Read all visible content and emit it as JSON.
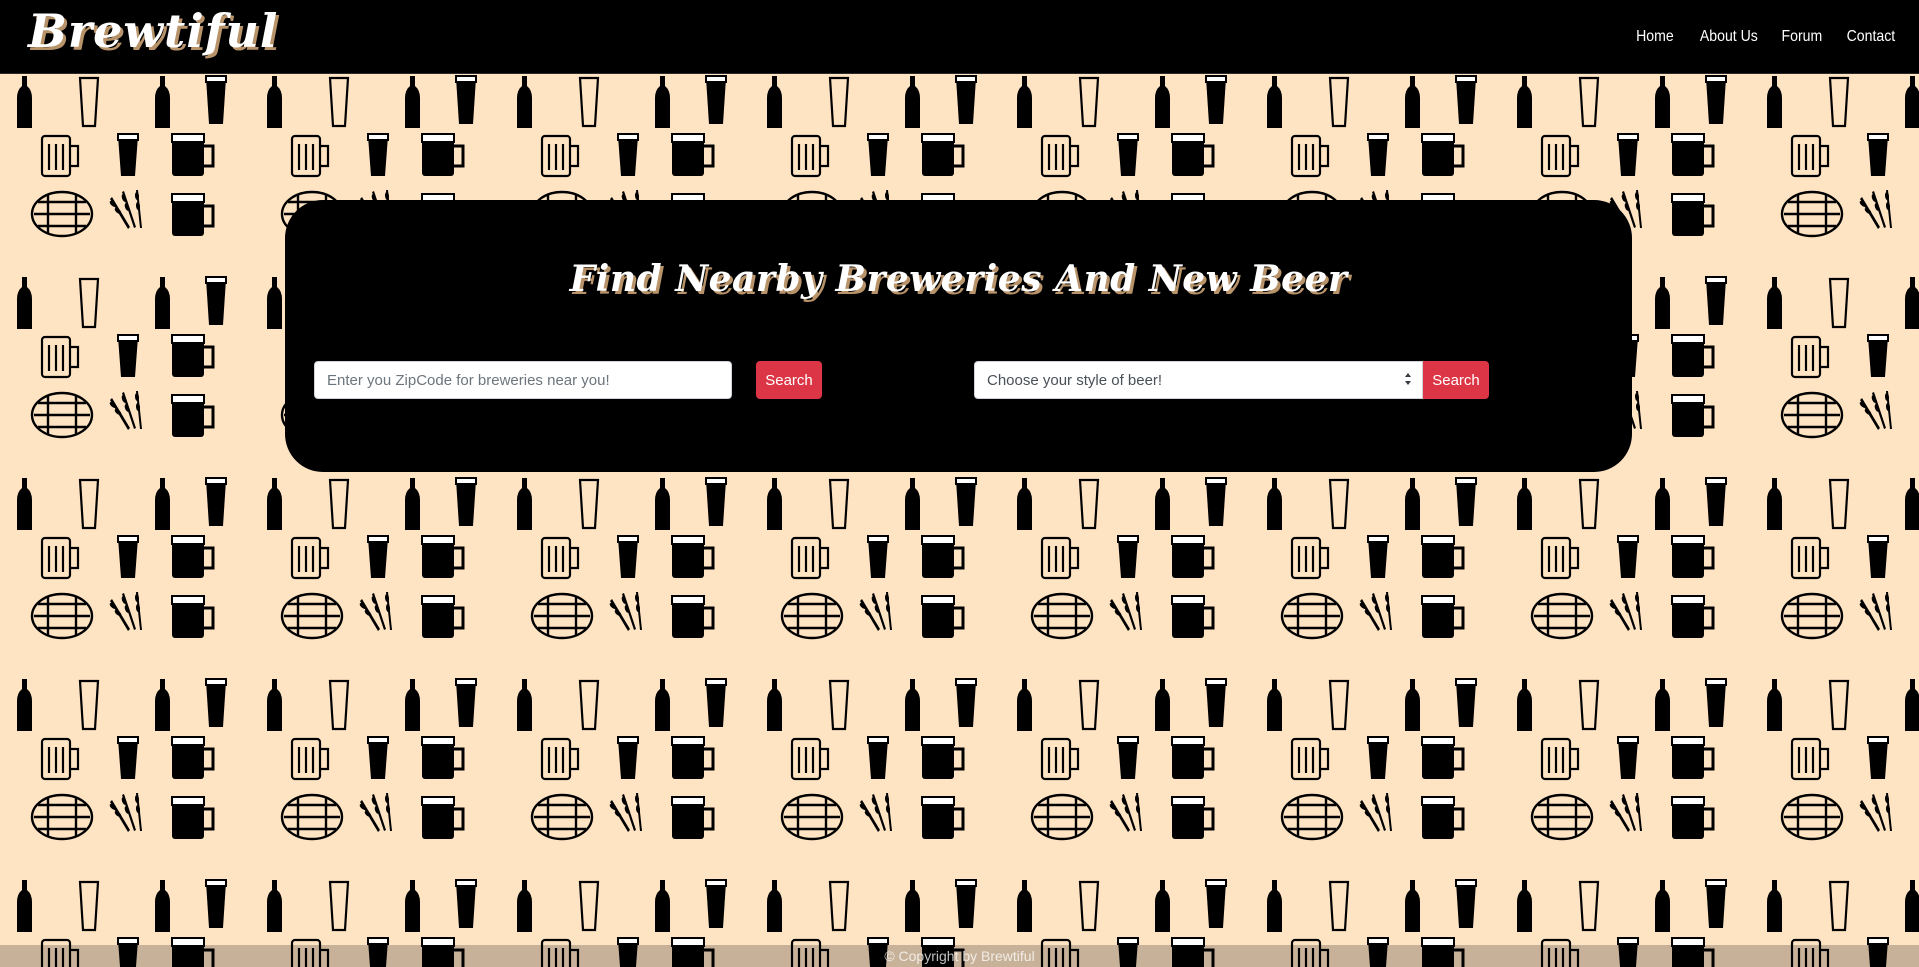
{
  "app": {
    "brand": "Brewtiful"
  },
  "nav": {
    "items": [
      {
        "label": "Home"
      },
      {
        "label": "About Us"
      },
      {
        "label": "Forum"
      },
      {
        "label": "Contact"
      }
    ]
  },
  "search": {
    "title": "Find Nearby Breweries And New Beer",
    "zip_placeholder": "Enter you ZipCode for breweries near you!",
    "zip_value": "",
    "zip_button": "Search",
    "style_selected": "Choose your style of beer!",
    "style_button": "Search"
  },
  "footer": {
    "text": "© Copyright by Brewtiful"
  },
  "colors": {
    "background": "#ffe4c4",
    "navbar": "#000000",
    "card": "#000000",
    "button": "#dc3545",
    "title_shadow": "#b8936a"
  },
  "icons": {
    "background_pattern": [
      "beer-bottle-icon",
      "pint-glass-icon",
      "beer-mug-icon",
      "barrel-icon",
      "wheat-icon"
    ]
  }
}
